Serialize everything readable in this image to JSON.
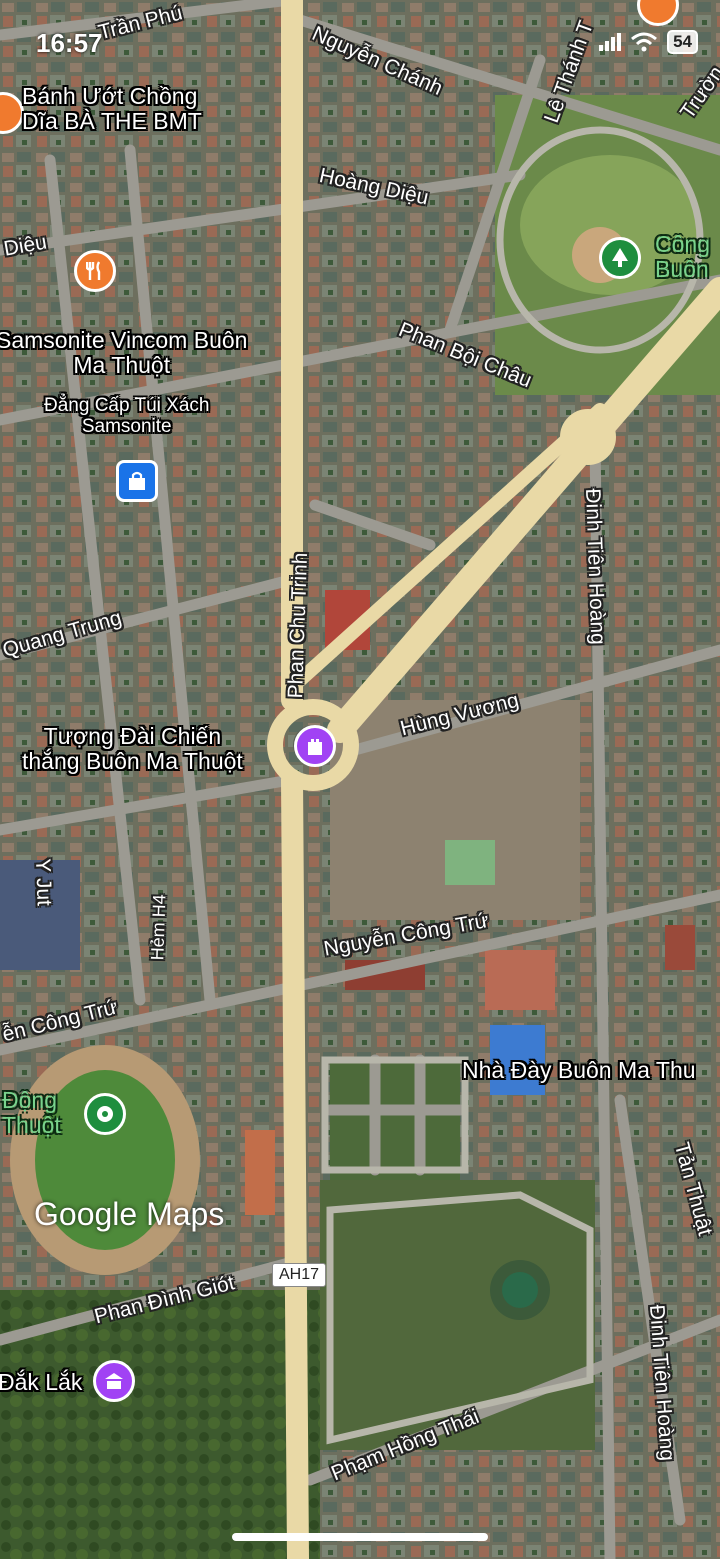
{
  "status_bar": {
    "time": "16:57",
    "battery": "54"
  },
  "places": {
    "banh_uot": "Bánh Ướt Chồng\nDĩa BÀ THE BMT",
    "samsonite_title": "Samsonite Vincom Buôn\nMa Thuột",
    "samsonite_sub": "Đẳng Cấp Túi Xách\nSamsonite",
    "tuong_dai": "Tượng Đài Chiến\nthắng Buôn Ma Thuột",
    "cong_vien": "Công\nBuôn",
    "nha_day": "Nhà Đày Buôn Ma Thu",
    "dong_thuot": "Động\nThuột",
    "dak_lak": "Đắk Lắk"
  },
  "roads": {
    "tran_phu": "Trần Phú",
    "nguyen_chanh": "Nguyễn Chánh",
    "le_thanh": "Lê Thánh T",
    "truong": "Trườn",
    "hoang_dieu": "Hoàng Diệu",
    "dieu": "Diệu",
    "phan_boi_chau": "Phan Bội Châu",
    "dinh_tien_hoang_1": "Đinh Tiên Hoàng",
    "phan_chu_trinh": "Phan Chu Trinh",
    "quang_trung": "Quang Trung",
    "hung_vuong": "Hùng Vương",
    "y_jut": "Y Jut",
    "hem_h4": "Hẻm H4",
    "nguyen_cong_tru_1": "Nguyễn Công Trứ",
    "nguyen_cong_tru_2": "ễn Công Trứ",
    "tan_thuat": "Tản Thuật",
    "phan_dinh_giot": "Phan Đình Giót",
    "pham_hong_thai": "Phạm Hồng Thái",
    "dinh_tien_hoang_2": "Đinh Tiên Hoàng"
  },
  "shield": "AH17",
  "logo": "Google Maps",
  "colors": {
    "food_poi": "#f07a2e",
    "shop_poi": "#1a73e8",
    "park_poi": "#1e8e3e",
    "landmark_poi": "#a142f4",
    "major_road": "#e9d9a6"
  }
}
